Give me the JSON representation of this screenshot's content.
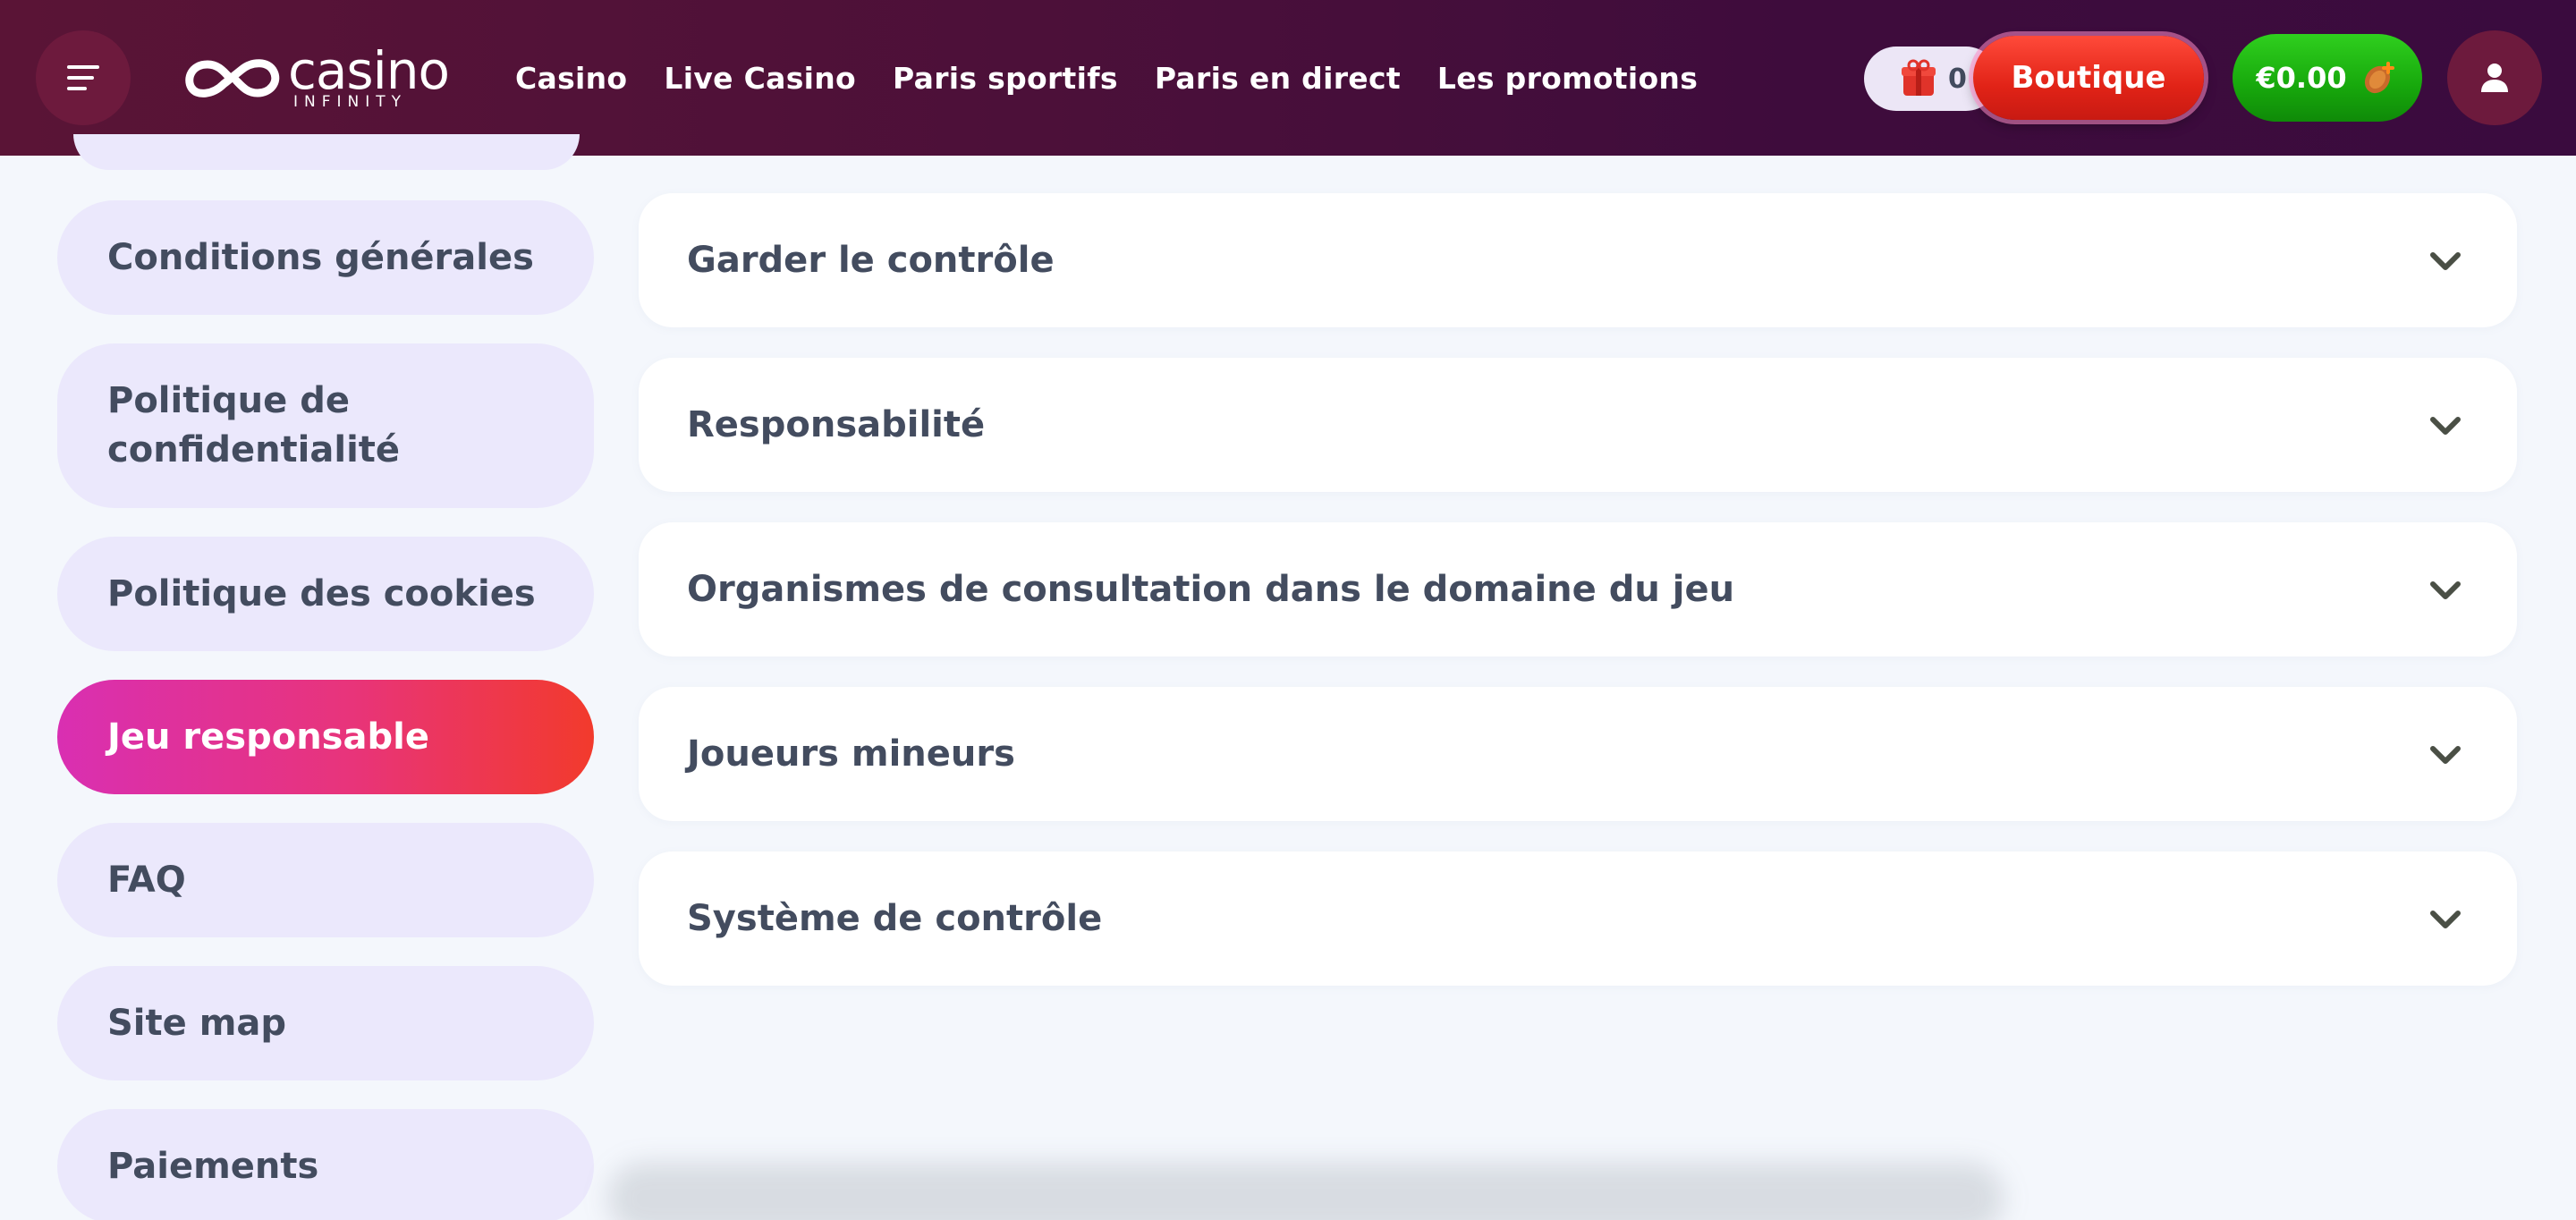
{
  "header": {
    "logo": {
      "word": "casino",
      "sub": "INFINITY"
    },
    "nav": [
      "Casino",
      "Live Casino",
      "Paris sportifs",
      "Paris en direct",
      "Les promotions"
    ],
    "coins_count": "0",
    "shop_label": "Boutique",
    "balance": "€0.00"
  },
  "sidebar": {
    "items": [
      {
        "label": "Conditions générales",
        "active": false
      },
      {
        "label": "Politique de confidentialité",
        "active": false
      },
      {
        "label": "Politique des cookies",
        "active": false
      },
      {
        "label": "Jeu responsable",
        "active": true
      },
      {
        "label": "FAQ",
        "active": false
      },
      {
        "label": "Site map",
        "active": false
      },
      {
        "label": "Paiements",
        "active": false
      }
    ]
  },
  "accordion": {
    "items": [
      "Garder le contrôle",
      "Responsabilité",
      "Organismes de consultation dans le domaine du jeu",
      "Joueurs mineurs",
      "Système de contrôle"
    ]
  },
  "colors": {
    "header_bg": "#4c1039",
    "active_gradient_start": "#d92fb2",
    "active_gradient_end": "#f23a2c",
    "shop_red": "#e12317",
    "wallet_green": "#17a80c",
    "sidebar_item_bg": "#ebe8fc",
    "page_bg": "#f4f7fc",
    "text": "#434c5f"
  }
}
